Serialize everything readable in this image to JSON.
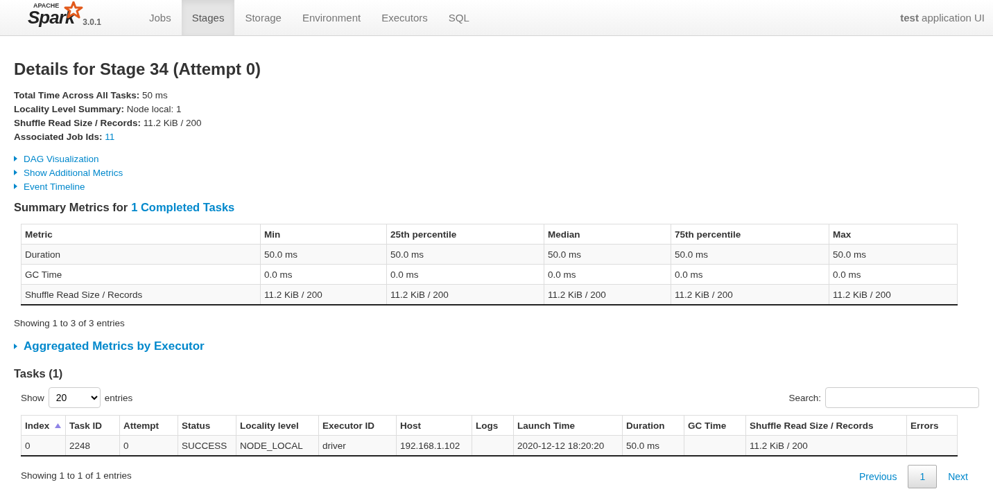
{
  "navbar": {
    "brand": {
      "small": "APACHE",
      "name": "Spark",
      "version": "3.0.1"
    },
    "tabs": [
      {
        "label": "Jobs",
        "selected": false
      },
      {
        "label": "Stages",
        "selected": true
      },
      {
        "label": "Storage",
        "selected": false
      },
      {
        "label": "Environment",
        "selected": false
      },
      {
        "label": "Executors",
        "selected": false
      },
      {
        "label": "SQL",
        "selected": false
      }
    ],
    "app_name": "**test** application UI"
  },
  "title": "Details for Stage 34 (Attempt 0)",
  "summary": [
    {
      "label": "Total Time Across All Tasks:",
      "value": "50 ms",
      "kind": "text"
    },
    {
      "label": "Locality Level Summary:",
      "value": "Node local: 1",
      "kind": "text"
    },
    {
      "label": "Shuffle Read Size / Records:",
      "value": "11.2 KiB / 200",
      "kind": "text"
    },
    {
      "label": "Associated Job Ids:",
      "value": "11",
      "kind": "link"
    }
  ],
  "toggles": [
    {
      "label": "DAG Visualization",
      "expanded": false
    },
    {
      "label": "Show Additional Metrics",
      "expanded": false
    },
    {
      "label": "Event Timeline",
      "expanded": false
    }
  ],
  "summary_metrics": {
    "heading": "Summary Metrics for",
    "heading_link": "1 Completed Tasks",
    "columns": [
      "Metric",
      "Min",
      "25th percentile",
      "Median",
      "75th percentile",
      "Max"
    ],
    "rows": [
      [
        "Duration",
        "50.0 ms",
        "50.0 ms",
        "50.0 ms",
        "50.0 ms",
        "50.0 ms"
      ],
      [
        "GC Time",
        "0.0 ms",
        "0.0 ms",
        "0.0 ms",
        "0.0 ms",
        "0.0 ms"
      ],
      [
        "Shuffle Read Size / Records",
        "11.2 KiB / 200",
        "11.2 KiB / 200",
        "11.2 KiB / 200",
        "11.2 KiB / 200",
        "11.2 KiB / 200"
      ]
    ],
    "info": "Showing 1 to 3 of 3 entries"
  },
  "aggregated": {
    "label": "Aggregated Metrics by Executor",
    "expanded": false
  },
  "tasks": {
    "heading": "Tasks (1)",
    "show_label": "Show",
    "page_size": "20",
    "entries_label": "entries",
    "search_label": "Search:",
    "columns": [
      {
        "label": "Index",
        "sorted": true
      },
      {
        "label": "Task ID",
        "sorted": false
      },
      {
        "label": "Attempt",
        "sorted": false
      },
      {
        "label": "Status",
        "sorted": false
      },
      {
        "label": "Locality level",
        "sorted": false
      },
      {
        "label": "Executor ID",
        "sorted": false
      },
      {
        "label": "Host",
        "sorted": false
      },
      {
        "label": "Logs",
        "sorted": false
      },
      {
        "label": "Launch Time",
        "sorted": false
      },
      {
        "label": "Duration",
        "sorted": false
      },
      {
        "label": "GC Time",
        "sorted": false
      },
      {
        "label": "Shuffle Read Size / Records",
        "sorted": false
      },
      {
        "label": "Errors",
        "sorted": false
      }
    ],
    "rows": [
      [
        "0",
        "2248",
        "0",
        "SUCCESS",
        "NODE_LOCAL",
        "driver",
        "192.168.1.102",
        "",
        "2020-12-12 18:20:20",
        "50.0 ms",
        "",
        "11.2 KiB / 200",
        ""
      ]
    ],
    "info": "Showing 1 to 1 of 1 entries",
    "pagination": {
      "previous": "Previous",
      "pages": [
        {
          "label": "1",
          "selected": true
        }
      ],
      "next": "Next"
    }
  }
}
